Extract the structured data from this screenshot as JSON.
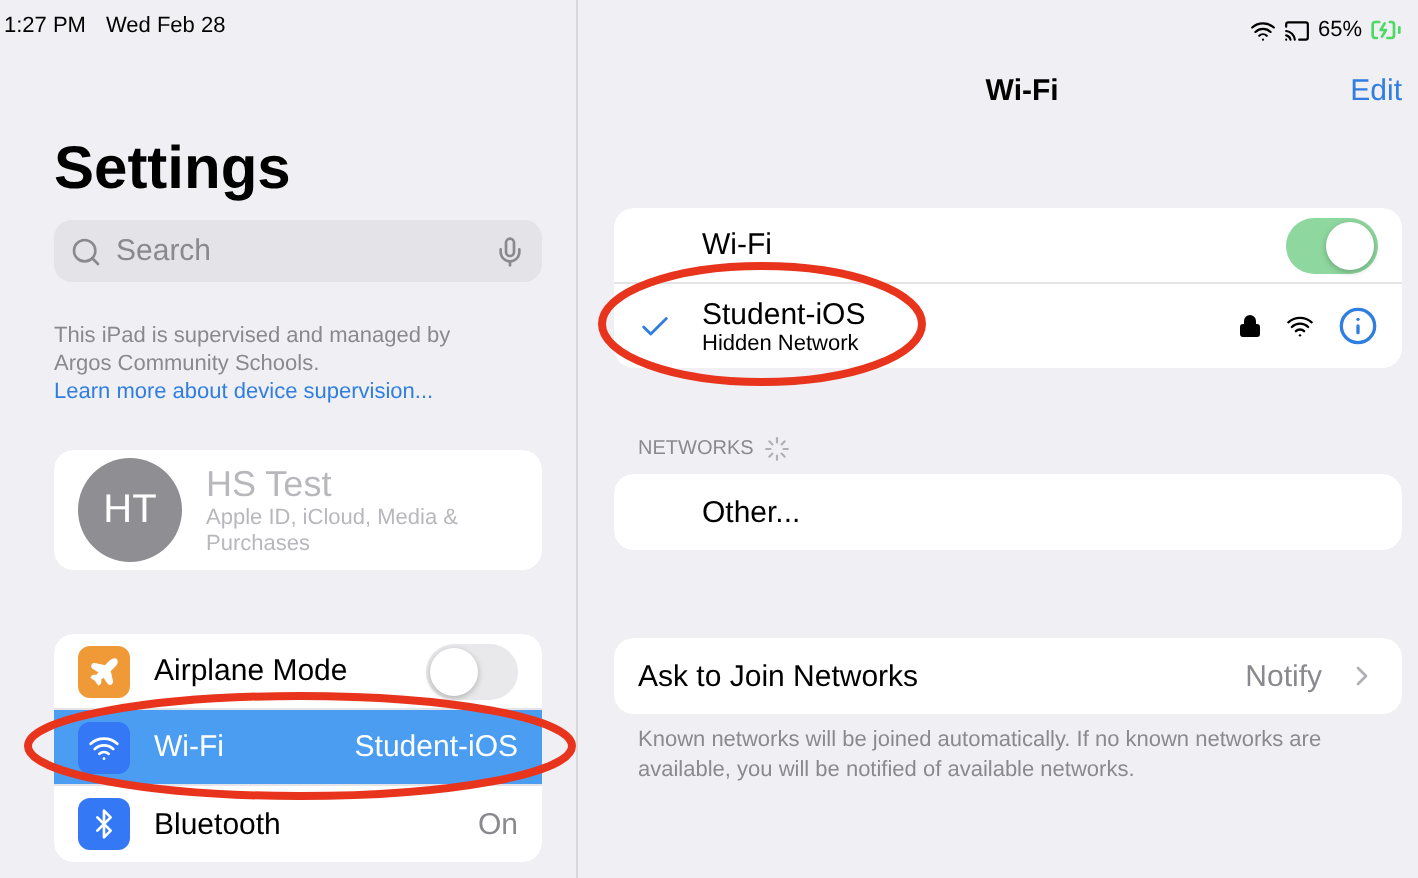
{
  "status_bar": {
    "time": "1:27 PM",
    "date": "Wed Feb 28",
    "battery": "65%",
    "charging": true
  },
  "sidebar": {
    "title": "Settings",
    "search": {
      "placeholder": "Search"
    },
    "supervision": {
      "text": "This iPad is supervised and managed by Argos Community Schools.",
      "link": "Learn more about device supervision..."
    },
    "profile": {
      "initials": "HT",
      "name": "HS Test",
      "subtitle": "Apple ID, iCloud, Media & Purchases"
    },
    "items": [
      {
        "kind": "toggle",
        "label": "Airplane Mode",
        "on": false,
        "selected": false,
        "color": "#f09a37"
      },
      {
        "kind": "value",
        "label": "Wi-Fi",
        "value": "Student-iOS",
        "selected": true,
        "color": "#3478f6"
      },
      {
        "kind": "value",
        "label": "Bluetooth",
        "value": "On",
        "selected": false,
        "color": "#3478f6"
      }
    ]
  },
  "detail": {
    "title": "Wi-Fi",
    "edit": "Edit",
    "wifi_toggle": {
      "label": "Wi-Fi",
      "on": true
    },
    "current_network": {
      "name": "Student-iOS",
      "subtitle": "Hidden Network",
      "connected": true,
      "locked": true
    },
    "networks_header": "NETWORKS",
    "networks": [
      {
        "label": "Other..."
      }
    ],
    "ask_to_join": {
      "label": "Ask to Join Networks",
      "value": "Notify"
    },
    "footnote": "Known networks will be joined automatically. If no known networks are available, you will be notified of available networks."
  }
}
